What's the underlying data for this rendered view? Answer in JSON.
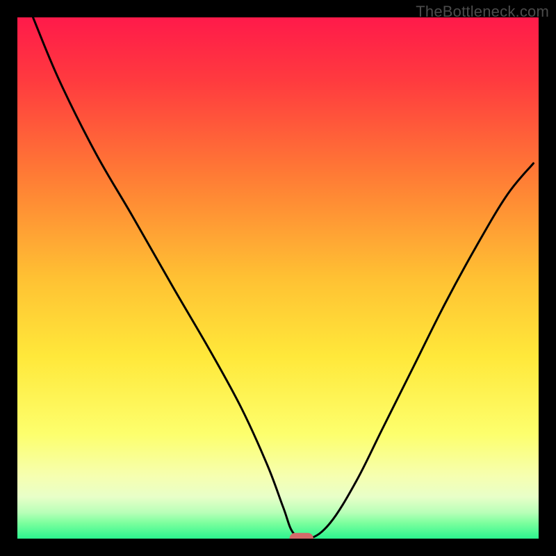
{
  "watermark": "TheBottleneck.com",
  "chart_data": {
    "type": "line",
    "title": "",
    "xlabel": "",
    "ylabel": "",
    "xlim": [
      0,
      100
    ],
    "ylim": [
      0,
      100
    ],
    "gradient_stops": [
      {
        "offset": 0,
        "color": "#ff1a4a"
      },
      {
        "offset": 12,
        "color": "#ff3a3f"
      },
      {
        "offset": 30,
        "color": "#ff7a35"
      },
      {
        "offset": 50,
        "color": "#ffc133"
      },
      {
        "offset": 65,
        "color": "#ffe83a"
      },
      {
        "offset": 80,
        "color": "#fdff6d"
      },
      {
        "offset": 88,
        "color": "#f6ffb0"
      },
      {
        "offset": 92,
        "color": "#e8ffc8"
      },
      {
        "offset": 95,
        "color": "#b8ffb8"
      },
      {
        "offset": 97,
        "color": "#7cff9e"
      },
      {
        "offset": 100,
        "color": "#2cf58e"
      }
    ],
    "series": [
      {
        "name": "bottleneck-curve",
        "color": "#000000",
        "x": [
          3,
          8,
          15,
          22,
          30,
          37,
          43,
          48,
          51,
          53,
          56,
          60,
          65,
          70,
          76,
          82,
          88,
          94,
          99
        ],
        "y": [
          100,
          88,
          74,
          62,
          48,
          36,
          25,
          14,
          6,
          1,
          0,
          3,
          11,
          21,
          33,
          45,
          56,
          66,
          72
        ]
      }
    ],
    "marker": {
      "x": 54.5,
      "y": 0,
      "rx": 2.3,
      "ry": 1.1,
      "color": "#d46a6a"
    }
  }
}
